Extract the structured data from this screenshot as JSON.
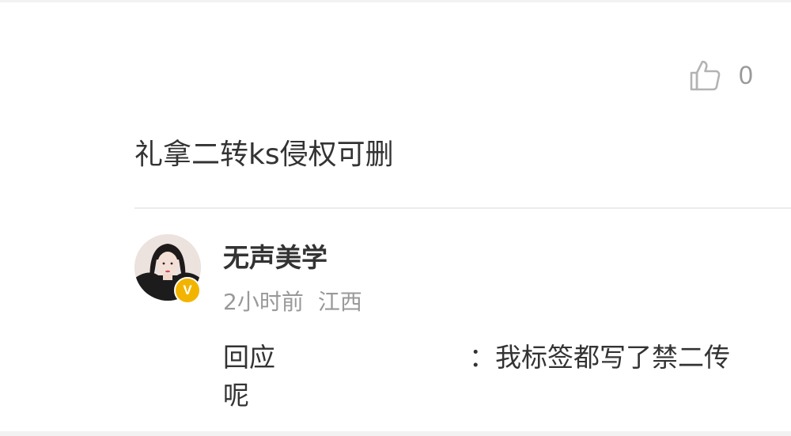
{
  "parent_comment": {
    "likes": "0",
    "text": "礼拿二转ks侵权可删"
  },
  "reply": {
    "username": "无声美学",
    "time": "2小时前",
    "location": "江西",
    "prefix": "回应",
    "separator": "：",
    "text": "我标签都写了禁二传呢"
  },
  "icons": {
    "like": "thumbs-up-icon",
    "verified": "verified-badge-icon"
  },
  "colors": {
    "verified_badge": "#f3b400",
    "primary_text": "#333333",
    "secondary_text": "#999999"
  }
}
